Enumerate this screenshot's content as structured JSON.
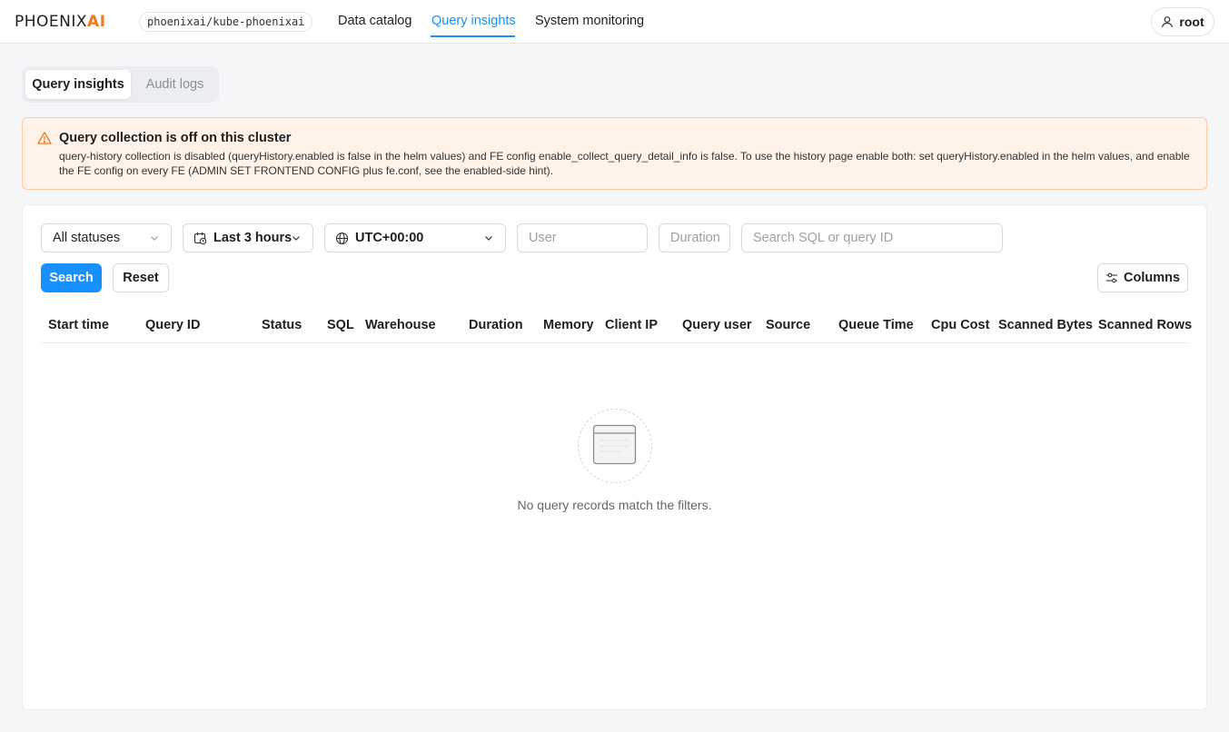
{
  "topbar": {
    "logo_main": "PHOENIX",
    "logo_accent": "AI",
    "cluster": "phoenixai/kube-phoenixai",
    "nav": [
      {
        "label": "Data catalog",
        "active": false
      },
      {
        "label": "Query insights",
        "active": true
      },
      {
        "label": "System monitoring",
        "active": false
      }
    ],
    "user": "root"
  },
  "tabs": [
    {
      "label": "Query insights",
      "active": true
    },
    {
      "label": "Audit logs",
      "active": false
    }
  ],
  "alert": {
    "title": "Query collection is off on this cluster",
    "body": "query-history collection is disabled (queryHistory.enabled is false in the helm values) and FE config enable_collect_query_detail_info is false. To use the history page enable both: set queryHistory.enabled in the helm values, and enable the FE config on every FE (ADMIN SET FRONTEND CONFIG plus fe.conf, see the enabled-side hint)."
  },
  "filters": {
    "status": "All statuses",
    "time_range": "Last 3 hours",
    "timezone": "UTC+00:00",
    "user_placeholder": "User",
    "duration_placeholder": "Duration",
    "search_placeholder": "Search SQL or query ID"
  },
  "actions": {
    "search": "Search",
    "reset": "Reset",
    "columns": "Columns"
  },
  "table": {
    "columns": [
      "Start time",
      "Query ID",
      "Status",
      "SQL",
      "Warehouse",
      "Duration",
      "Memory",
      "Client IP",
      "Query user",
      "Source",
      "Queue Time",
      "Cpu Cost",
      "Scanned Bytes",
      "Scanned Rows"
    ],
    "rows": [],
    "empty_text": "No query records match the filters."
  },
  "colors": {
    "accent": "#1890ff",
    "brand": "#f07a1a",
    "warning_bg": "#fff2e8",
    "warning_border": "#ffc9a6"
  }
}
